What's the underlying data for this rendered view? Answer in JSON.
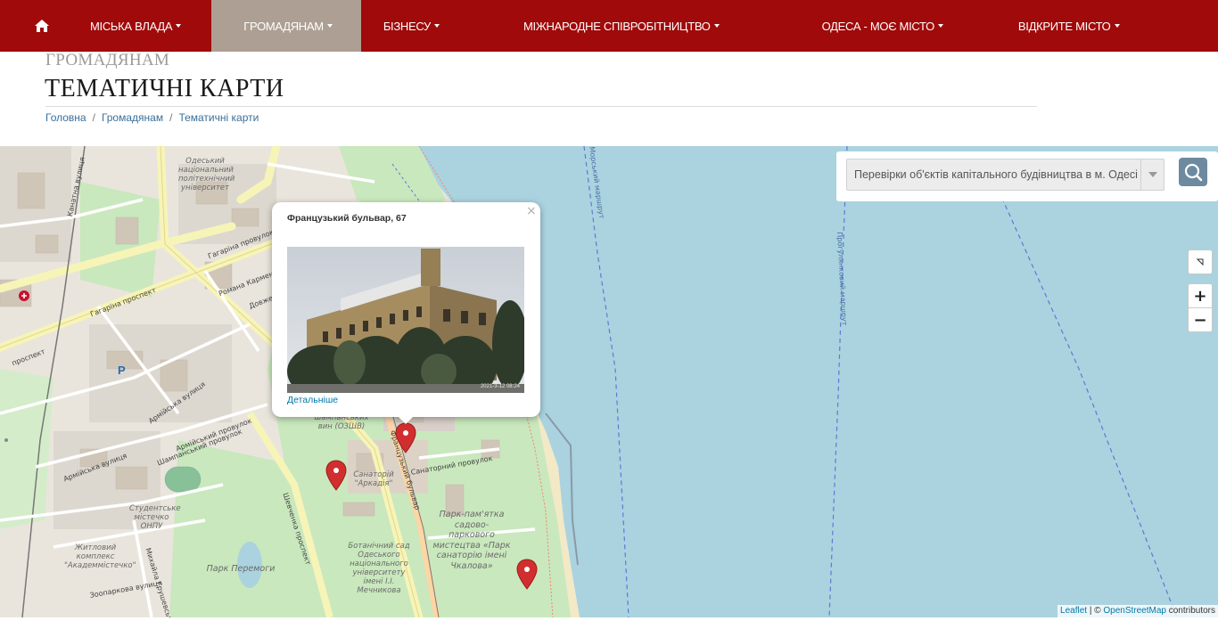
{
  "nav": {
    "items": [
      {
        "label": "Міська влада"
      },
      {
        "label": "Громадянам"
      },
      {
        "label": "Бізнесу"
      },
      {
        "label": "Міжнародне співробітництво"
      },
      {
        "label": "Одеса - моє місто"
      },
      {
        "label": "Відкрите місто"
      }
    ],
    "active_color": "#ad9f93",
    "bar_color": "#a00a0a"
  },
  "header": {
    "section": "ГРОМАДЯНАМ",
    "title": "ТЕМАТИЧНІ КАРТИ"
  },
  "breadcrumb": {
    "items": [
      "Головна",
      "Громадянам",
      "Тематичні карти"
    ]
  },
  "map": {
    "layer_select": {
      "value": "Перевірки об'єктів капітального будівництва в м. Одесі"
    },
    "zoom": {
      "in": "+",
      "out": "−"
    },
    "attribution": {
      "leaflet": "Leaflet",
      "sep": " | © ",
      "osm": "OpenStreetMap",
      "suffix": " contributors"
    },
    "popup": {
      "title": "Французький бульвар, 67",
      "link": "Детальніше",
      "photo_date": "2021-3-12 08:24",
      "close": "×"
    },
    "labels": {
      "univ": "Одеський національний політехнічний університет",
      "zavod": "Завод шампанських вин (ОЗШВ)",
      "sanatorium": "Санаторій \"Аркадія\"",
      "park_chkalov": "Парк-пам'ятка садово-паркового мистецтва «Парк санаторію імені Чкалова»",
      "bot_sad": "Ботанічний сад Одеського національного університету імені І.І. Мечникова",
      "student": "Студентське містечко ОНПУ",
      "akadem": "Житловий комплекс \"Академмістечко\"",
      "park_peremohy": "Парк Перемоги",
      "parking": "P",
      "sea_route_1": "Морський маршрут",
      "sea_route_2": "Прогулянковий маршрут"
    },
    "streets": {
      "hagarina_prospekt": "Гагаріна проспект",
      "hagarina_provulok": "Гагаріна провулок",
      "kanatna": "Канатна вулиця",
      "romana": "Романа Кармена вулиця",
      "armiiska": "Армійська вулиця",
      "armiiskyi_prov": "Армійський провулок",
      "shampanskyi": "Шампанський провулок",
      "shevchenka": "Шевченка проспект",
      "frantsuzkyi": "Французький бульвар",
      "sanatornyi": "Санаторний провулок",
      "mykhaila": "Михайла Грушевського",
      "zooparkova": "Зоопаркова вулиця",
      "dovzhenka": "Довженка",
      "prospekt": "проспект"
    }
  }
}
